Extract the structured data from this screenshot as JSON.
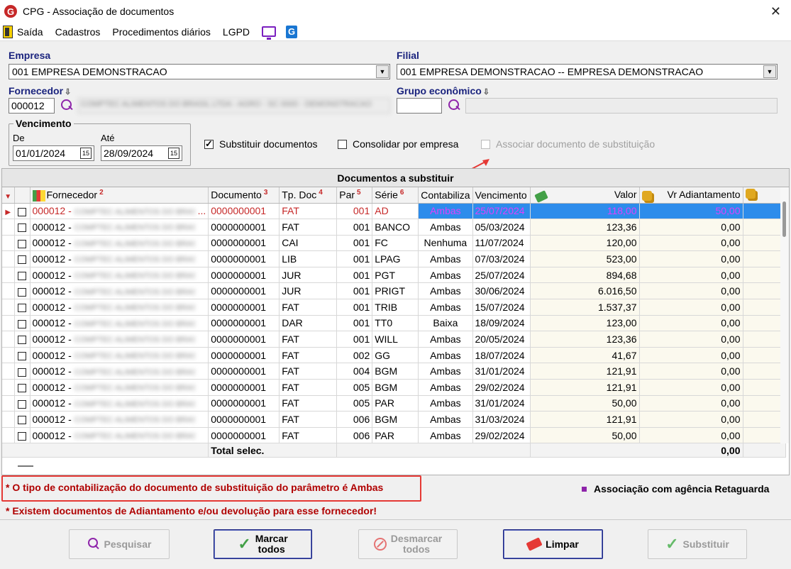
{
  "window": {
    "logo_letter": "G",
    "title": "CPG - Associação de documentos",
    "close_glyph": "✕"
  },
  "menu": [
    "Saída",
    "Cadastros",
    "Procedimentos diários",
    "LGPD"
  ],
  "filters": {
    "empresa_label": "Empresa",
    "empresa_value": "001 EMPRESA DEMONSTRACAO",
    "filial_label": "Filial",
    "filial_value": "001 EMPRESA DEMONSTRACAO -- EMPRESA DEMONSTRACAO",
    "fornecedor_label": "Fornecedor",
    "fornecedor_code": "000012",
    "fornecedor_name": "COMPTEC ALIMENTOS DO BRASIL LTDA - AGRO - SC 0000 - DEMONSTRACAO",
    "grupo_label": "Grupo econômico",
    "grupo_code": "",
    "vencimento_label": "Vencimento",
    "de_label": "De",
    "de_value": "01/01/2024",
    "ate_label": "Até",
    "ate_value": "28/09/2024",
    "cal_glyph": "15",
    "pin_glyph": "⇩"
  },
  "options": {
    "substituir": {
      "label": "Substituir documentos",
      "checked": true
    },
    "consolidar": {
      "label": "Consolidar por empresa",
      "checked": false
    },
    "associar": {
      "label": "Associar documento de substituição",
      "checked": false,
      "disabled": true
    }
  },
  "grid": {
    "caption": "Documentos a substituir",
    "columns": {
      "fornecedor": "Fornecedor",
      "fornecedor_n": "2",
      "documento": "Documento",
      "documento_n": "3",
      "tpdoc": "Tp. Doc",
      "tpdoc_n": "4",
      "par": "Par",
      "par_n": "5",
      "serie": "Série",
      "serie_n": "6",
      "contabiliza": "Contabiliza",
      "vencimento": "Vencimento",
      "valor": "Valor",
      "vr_adiantamento": "Vr Adiantamento"
    },
    "rows": [
      {
        "forn": "000012 -",
        "forn_rest": "...",
        "doc": "0000000001",
        "tp": "FAT",
        "par": "001",
        "serie": "AD",
        "cont": "Ambas",
        "venc": "25/07/2024",
        "valor": "118,00",
        "adiant": "50,00",
        "selected": true
      },
      {
        "forn": "000012 -",
        "forn_rest": "",
        "doc": "0000000001",
        "tp": "FAT",
        "par": "001",
        "serie": "BANCO",
        "cont": "Ambas",
        "venc": "05/03/2024",
        "valor": "123,36",
        "adiant": "0,00"
      },
      {
        "forn": "000012 -",
        "forn_rest": "",
        "doc": "0000000001",
        "tp": "CAI",
        "par": "001",
        "serie": "FC",
        "cont": "Nenhuma",
        "venc": "11/07/2024",
        "valor": "120,00",
        "adiant": "0,00"
      },
      {
        "forn": "000012 -",
        "forn_rest": "",
        "doc": "0000000001",
        "tp": "LIB",
        "par": "001",
        "serie": "LPAG",
        "cont": "Ambas",
        "venc": "07/03/2024",
        "valor": "523,00",
        "adiant": "0,00"
      },
      {
        "forn": "000012 -",
        "forn_rest": "",
        "doc": "0000000001",
        "tp": "JUR",
        "par": "001",
        "serie": "PGT",
        "cont": "Ambas",
        "venc": "25/07/2024",
        "valor": "894,68",
        "adiant": "0,00"
      },
      {
        "forn": "000012 -",
        "forn_rest": "",
        "doc": "0000000001",
        "tp": "JUR",
        "par": "001",
        "serie": "PRIGT",
        "cont": "Ambas",
        "venc": "30/06/2024",
        "valor": "6.016,50",
        "adiant": "0,00"
      },
      {
        "forn": "000012 -",
        "forn_rest": "",
        "doc": "0000000001",
        "tp": "FAT",
        "par": "001",
        "serie": "TRIB",
        "cont": "Ambas",
        "venc": "15/07/2024",
        "valor": "1.537,37",
        "adiant": "0,00"
      },
      {
        "forn": "000012 -",
        "forn_rest": "",
        "doc": "0000000001",
        "tp": "DAR",
        "par": "001",
        "serie": "TT0",
        "cont": "Baixa",
        "venc": "18/09/2024",
        "valor": "123,00",
        "adiant": "0,00"
      },
      {
        "forn": "000012 -",
        "forn_rest": "",
        "doc": "0000000001",
        "tp": "FAT",
        "par": "001",
        "serie": "WILL",
        "cont": "Ambas",
        "venc": "20/05/2024",
        "valor": "123,36",
        "adiant": "0,00"
      },
      {
        "forn": "000012 -",
        "forn_rest": "",
        "doc": "0000000001",
        "tp": "FAT",
        "par": "002",
        "serie": "GG",
        "cont": "Ambas",
        "venc": "18/07/2024",
        "valor": "41,67",
        "adiant": "0,00"
      },
      {
        "forn": "000012 -",
        "forn_rest": "",
        "doc": "0000000001",
        "tp": "FAT",
        "par": "004",
        "serie": "BGM",
        "cont": "Ambas",
        "venc": "31/01/2024",
        "valor": "121,91",
        "adiant": "0,00"
      },
      {
        "forn": "000012 -",
        "forn_rest": "",
        "doc": "0000000001",
        "tp": "FAT",
        "par": "005",
        "serie": "BGM",
        "cont": "Ambas",
        "venc": "29/02/2024",
        "valor": "121,91",
        "adiant": "0,00"
      },
      {
        "forn": "000012 -",
        "forn_rest": "",
        "doc": "0000000001",
        "tp": "FAT",
        "par": "005",
        "serie": "PAR",
        "cont": "Ambas",
        "venc": "31/01/2024",
        "valor": "50,00",
        "adiant": "0,00"
      },
      {
        "forn": "000012 -",
        "forn_rest": "",
        "doc": "0000000001",
        "tp": "FAT",
        "par": "006",
        "serie": "BGM",
        "cont": "Ambas",
        "venc": "31/03/2024",
        "valor": "121,91",
        "adiant": "0,00"
      },
      {
        "forn": "000012 -",
        "forn_rest": "",
        "doc": "0000000001",
        "tp": "FAT",
        "par": "006",
        "serie": "PAR",
        "cont": "Ambas",
        "venc": "29/02/2024",
        "valor": "50,00",
        "adiant": "0,00"
      }
    ],
    "total_label": "Total selec.",
    "total_value": "0,00"
  },
  "notes": {
    "note1": "* O tipo de contabilização do documento de substituição do parâmetro é Ambas",
    "note2": "* Existem documentos de Adiantamento e/ou devolução para esse fornecedor!",
    "legend": "Associação com agência Retaguarda"
  },
  "buttons": {
    "pesquisar": "Pesquisar",
    "marcar_1": "Marcar",
    "marcar_2": "todos",
    "desmarcar_1": "Desmarcar",
    "desmarcar_2": "todos",
    "limpar": "Limpar",
    "substituir": "Substituir"
  },
  "colors": {
    "accent_blue": "#2d8ceb",
    "label_navy": "#1a237e",
    "alert_red": "#b00000",
    "legend_purple": "#8e24aa"
  }
}
